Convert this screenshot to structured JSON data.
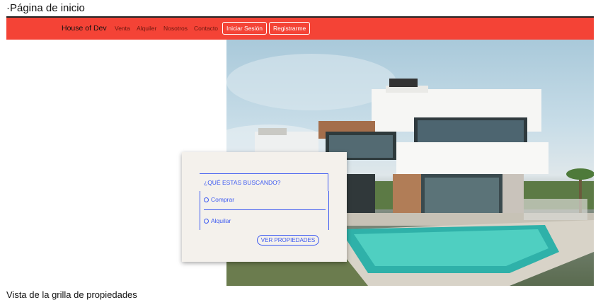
{
  "page": {
    "heading": "·Página de inicio"
  },
  "navbar": {
    "brand": "House of Dev",
    "links": [
      "Venta",
      "Alquiler",
      "Nosotros",
      "Contacto"
    ],
    "login_label": "Iniciar Sesión",
    "register_label": "Registrarme"
  },
  "hero": {
    "image": "modern-house-with-pool"
  },
  "search": {
    "title": "¿QUÉ ESTAS BUSCANDO?",
    "options": [
      "Comprar",
      "Alquilar"
    ],
    "button_label": "VER PROPIEDADES"
  },
  "footer": {
    "partial_text": "Vista de la grilla de propiedades"
  },
  "colors": {
    "navbar": "#f44336",
    "accent": "#3d5af1",
    "card": "#f4f1ec"
  }
}
